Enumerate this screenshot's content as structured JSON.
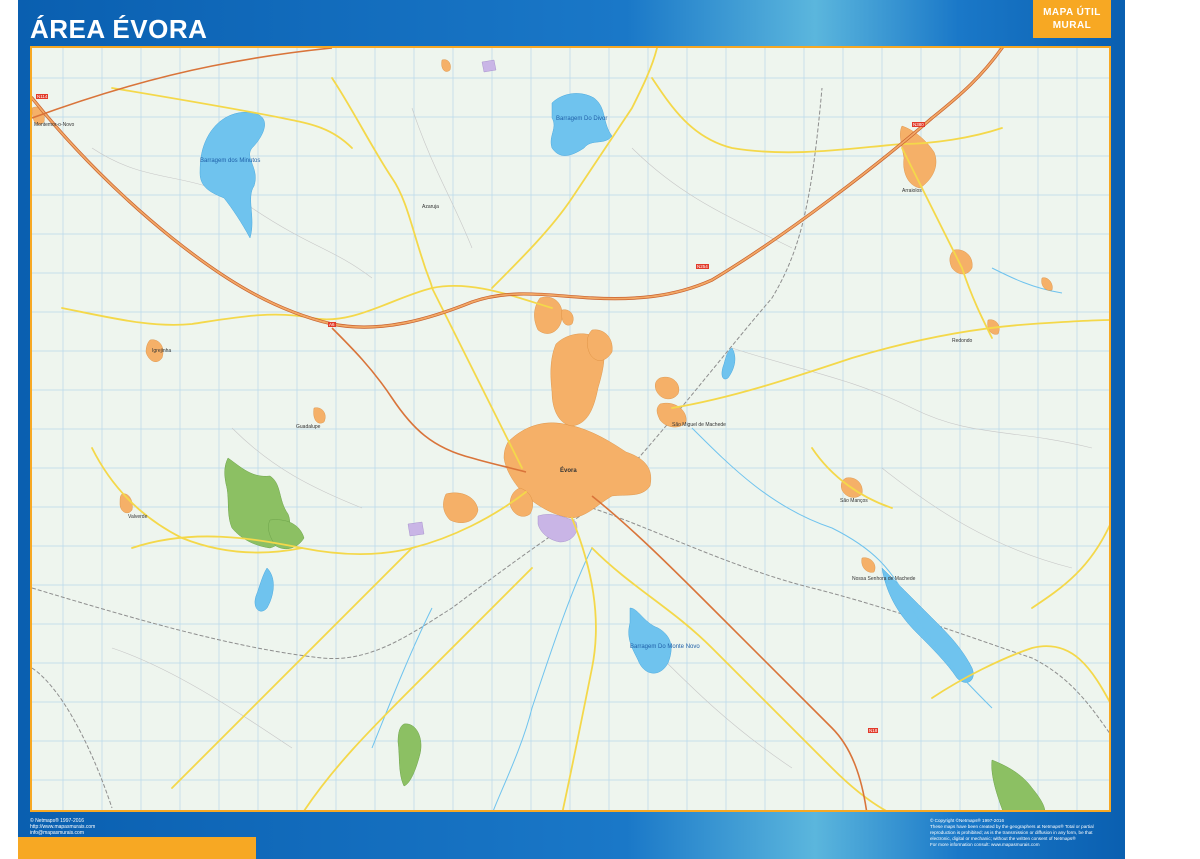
{
  "header": {
    "title": "ÁREA ÉVORA",
    "badge_line1": "MAPA ÚTIL",
    "badge_line2": "MURAL"
  },
  "colors": {
    "frame_blue": "#0a5fb0",
    "accent_orange": "#f7a823",
    "map_background": "#eef5ee",
    "urban_area": "#f5b068",
    "park_area": "#8cc063",
    "water": "#6fc3ee",
    "highway": "#e89a4a",
    "main_road": "#f4d84a",
    "railway": "#9a9a9a",
    "grid": "#b9d8ea"
  },
  "map": {
    "water_labels": [
      {
        "text": "Barragem dos Minutos"
      },
      {
        "text": "Barragem Do Monte Novo"
      },
      {
        "text": "Barragem Do Divor"
      }
    ],
    "place_labels": [
      {
        "text": "Évora"
      },
      {
        "text": "Arraiolos"
      },
      {
        "text": "Montemor-o-Novo"
      },
      {
        "text": "Redondo"
      },
      {
        "text": "Valverde"
      },
      {
        "text": "Azaruja"
      },
      {
        "text": "São Manços"
      },
      {
        "text": "Guadalupe"
      },
      {
        "text": "Nossa Senhora de Machede"
      },
      {
        "text": "Igrejinha"
      },
      {
        "text": "São Miguel de Machede"
      }
    ],
    "road_labels": [
      {
        "text": "A6"
      },
      {
        "text": "N114"
      },
      {
        "text": "N18"
      },
      {
        "text": "N254"
      },
      {
        "text": "N380"
      }
    ]
  },
  "footer": {
    "left_line1": "© Netmaps® 1997-2016",
    "left_line2": "http://www.mapasmurais.com",
    "left_line3": "info@mapasmurais.com",
    "right_line1": "© Copyright ©Netmaps® 1997-2016",
    "right_line2": "These maps have been created by the geographers at Netmaps® Total or partial",
    "right_line3": "reproduction is prohibited; as is the transmission or diffusion in any form, be that",
    "right_line4": "electronic, digital or mechanic; without the written consent of Netmaps®",
    "right_line5": "For more information consult: www.mapasmurais.com"
  }
}
